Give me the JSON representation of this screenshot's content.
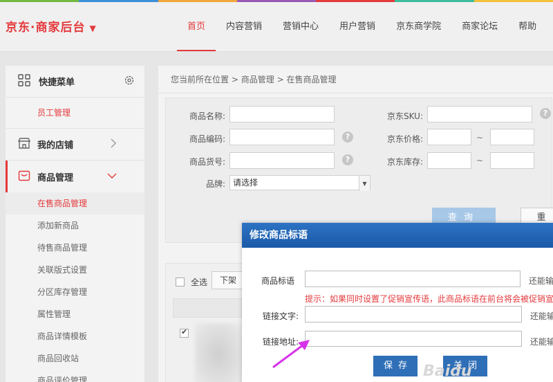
{
  "colors": {
    "brand_red": "#e4393c",
    "dialog_blue": "#1a5aa8",
    "strip": [
      "#73b940",
      "#3c8fd8",
      "#f0a63a",
      "#9b59b6",
      "#e4393c",
      "#3dbd9e",
      "#f3c13a"
    ]
  },
  "header": {
    "logo": "京东·商家后台",
    "nav": [
      "首页",
      "内容营销",
      "营销中心",
      "用户营销",
      "京东商学院",
      "商家论坛",
      "帮助"
    ],
    "active_nav": "首页"
  },
  "sidebar": {
    "quick_menu": "快捷菜单",
    "quick_item": "员工管理",
    "my_store": "我的店铺",
    "goods_mgmt": "商品管理",
    "items": [
      "在售商品管理",
      "添加新商品",
      "待售商品管理",
      "关联版式设置",
      "分区库存管理",
      "属性管理",
      "商品详情模板",
      "商品回收站",
      "商品评价管理"
    ],
    "icons": [
      "grid-icon",
      "gear-icon",
      "store-icon",
      "chevron-right-icon",
      "goods-icon",
      "chevron-down-icon"
    ]
  },
  "breadcrumb": {
    "prefix": "您当前所在位置",
    "level1": "商品管理",
    "level2": "在售商品管理",
    "sep": ">"
  },
  "search": {
    "name_label": "商品名称:",
    "code_label": "商品编码:",
    "no_label": "商品货号:",
    "brand_label": "品牌:",
    "brand_value": "请选择",
    "sku_label": "京东SKU:",
    "price_label": "京东价格:",
    "stock_label": "京东库存:",
    "range_sep": "~",
    "query": "查询",
    "reset": "重"
  },
  "list": {
    "select_all": "全选",
    "off_shelf": "下架"
  },
  "dialog": {
    "title": "修改商品标语",
    "slogan_label": "商品标语",
    "slogan_tip": "还能输",
    "note": "提示：如果同时设置了促销宣传语，此商品标语在前台将会被促销宣",
    "link_text_label": "链接文字:",
    "link_text_tip": "还能输",
    "link_url_label": "链接地址:",
    "link_url_tip": "还能输",
    "save": "保存",
    "close": "关闭"
  },
  "watermark": "Baidu"
}
